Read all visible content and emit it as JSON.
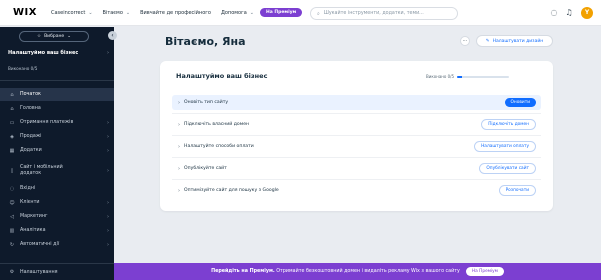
{
  "topbar": {
    "logo": "WIX",
    "site_name": "Caseincorrect",
    "links": [
      "Вітаємо",
      "Вивчайте де професійного",
      "Допомога"
    ],
    "premium_label": "На Преміум",
    "search_placeholder": "Шукайте інструменти, додатки, теми...",
    "avatar_letter": "Y"
  },
  "sidebar": {
    "favorites_label": "Вибране",
    "setup_title": "Налаштуймо ваш бізнес",
    "setup_progress": "Виконано 0/5",
    "items": [
      {
        "icon": "home-icon",
        "glyph": "⌂",
        "label": "Початок",
        "active": true
      },
      {
        "icon": "home-icon",
        "glyph": "⌂",
        "label": "Головна"
      },
      {
        "icon": "payment-icon",
        "glyph": "▭",
        "label": "Отримання платежів"
      },
      {
        "icon": "tag-icon",
        "glyph": "◈",
        "label": "Продажі"
      },
      {
        "icon": "apps-icon",
        "glyph": "▦",
        "label": "Додатки"
      },
      {
        "icon": "mobile-icon",
        "glyph": "▯",
        "label": "Сайт і мобільний додаток"
      },
      {
        "icon": "chat-icon",
        "glyph": "◌",
        "label": "Вхідні"
      },
      {
        "icon": "people-icon",
        "glyph": "☺",
        "label": "Клієнти"
      },
      {
        "icon": "megaphone-icon",
        "glyph": "◁",
        "label": "Маркетинг"
      },
      {
        "icon": "chart-icon",
        "glyph": "▥",
        "label": "Аналітика"
      },
      {
        "icon": "automation-icon",
        "glyph": "↻",
        "label": "Автоматичні дії"
      }
    ],
    "settings_label": "Налаштування"
  },
  "main": {
    "greeting": "Вітаємо, Яна",
    "customize_label": "Налаштувати дизайн",
    "card": {
      "title": "Налаштуймо ваш бізнес",
      "progress_label": "Виконано 0/5",
      "progress_fraction": 0.1,
      "tasks": [
        {
          "label": "Оновіть тип сайту",
          "button": "Оновити",
          "primary": true
        },
        {
          "label": "Підключіть власний домен",
          "button": "Підключіть домен"
        },
        {
          "label": "Налаштуйте способи оплати",
          "button": "Налаштувати оплату"
        },
        {
          "label": "Опублікуйте сайт",
          "button": "Опублікувати сайт"
        },
        {
          "label": "Оптимізуйте сайт для пошуку з Google",
          "button": "Розпочати"
        }
      ]
    }
  },
  "promo": {
    "text_bold": "Перейдіть на Преміум.",
    "text": "Отримайте безкоштовний домен і видаліть рекламу Wix з вашого сайту",
    "button": "На Преміум"
  },
  "colors": {
    "accent": "#116dff",
    "premium": "#7c3fd1",
    "sidebar_bg": "#0e1a2b",
    "avatar": "#f2a100"
  }
}
